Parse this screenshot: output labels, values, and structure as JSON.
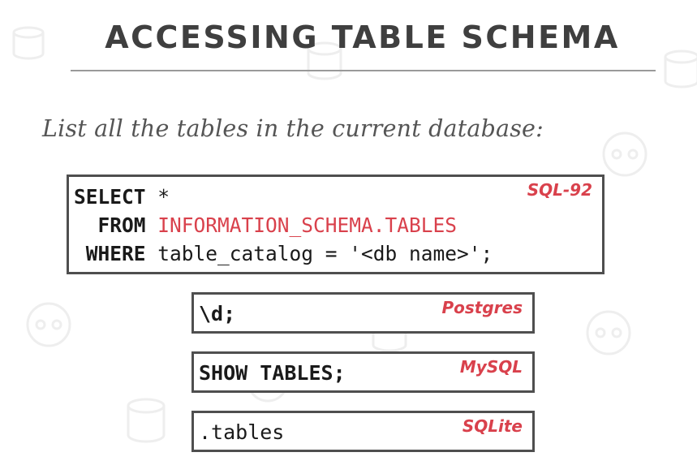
{
  "slide": {
    "title": "ACCESSING TABLE SCHEMA",
    "subtitle": "List all the tables in the current database:"
  },
  "sql92": {
    "dialect": "SQL-92",
    "line1_kw": "SELECT",
    "line1_rest": " *",
    "line2_kw": "FROM",
    "line2_rest": "INFORMATION_SCHEMA.TABLES",
    "line3_kw": "WHERE",
    "line3_rest": "table_catalog = '<db name>';"
  },
  "postgres": {
    "dialect": "Postgres",
    "code": "\\d;"
  },
  "mysql": {
    "dialect": "MySQL",
    "code": "SHOW TABLES;"
  },
  "sqlite": {
    "dialect": "SQLite",
    "code": ".tables"
  },
  "colors": {
    "accent_red": "#d9414c",
    "title_gray": "#3f3f3f",
    "border": "#4f4f4f"
  }
}
